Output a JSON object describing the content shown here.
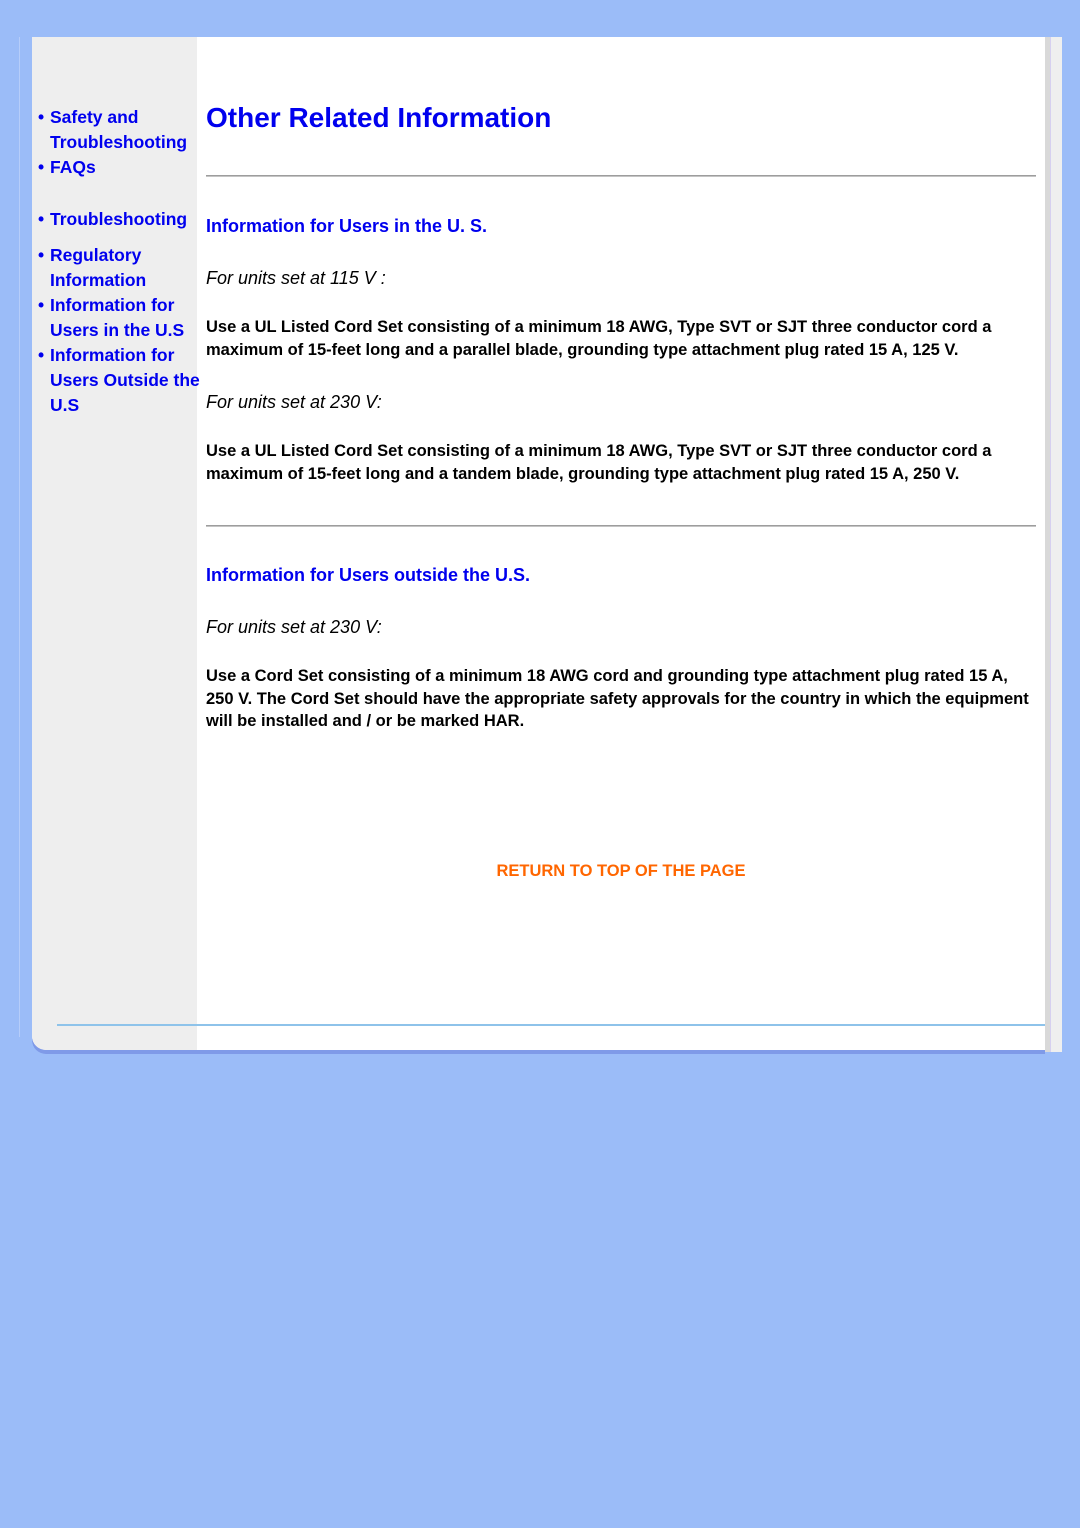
{
  "colors": {
    "background": "#9bbcf8",
    "link": "#0000ee",
    "return_link": "#ff6600",
    "sidebar": "#eeeeee"
  },
  "sidebar": {
    "items": [
      {
        "label": "Safety and Troubleshooting"
      },
      {
        "label": "FAQs"
      },
      {
        "label": "Troubleshooting"
      },
      {
        "label": "Regulatory Information"
      },
      {
        "label": "Information for Users in the U.S"
      },
      {
        "label": "Information for Users Outside the U.S"
      }
    ]
  },
  "main": {
    "title": "Other Related Information",
    "us_section": {
      "heading": "Information for Users in the U. S.",
      "sub1": "For units set at 115 V :",
      "text1": "Use a UL Listed Cord Set consisting of a minimum 18 AWG, Type SVT or SJT three conductor cord a maximum of 15-feet long and a parallel blade, grounding type attachment plug rated 15 A, 125 V.",
      "sub2": "For units set at 230 V:",
      "text2": "Use a UL Listed Cord Set consisting of a minimum 18 AWG, Type SVT or SJT three conductor cord a maximum of 15-feet long and a tandem blade, grounding type attachment plug rated 15 A, 250 V."
    },
    "outside_section": {
      "heading": "Information for Users outside the U.S.",
      "sub1": "For units set at 230 V:",
      "text1": "Use a Cord Set consisting of a minimum 18 AWG cord and grounding type attachment plug rated 15 A, 250 V. The Cord Set should have the appropriate safety approvals for the country in which the equipment will be installed and / or be marked HAR."
    },
    "return_link": "RETURN TO TOP OF THE PAGE"
  }
}
